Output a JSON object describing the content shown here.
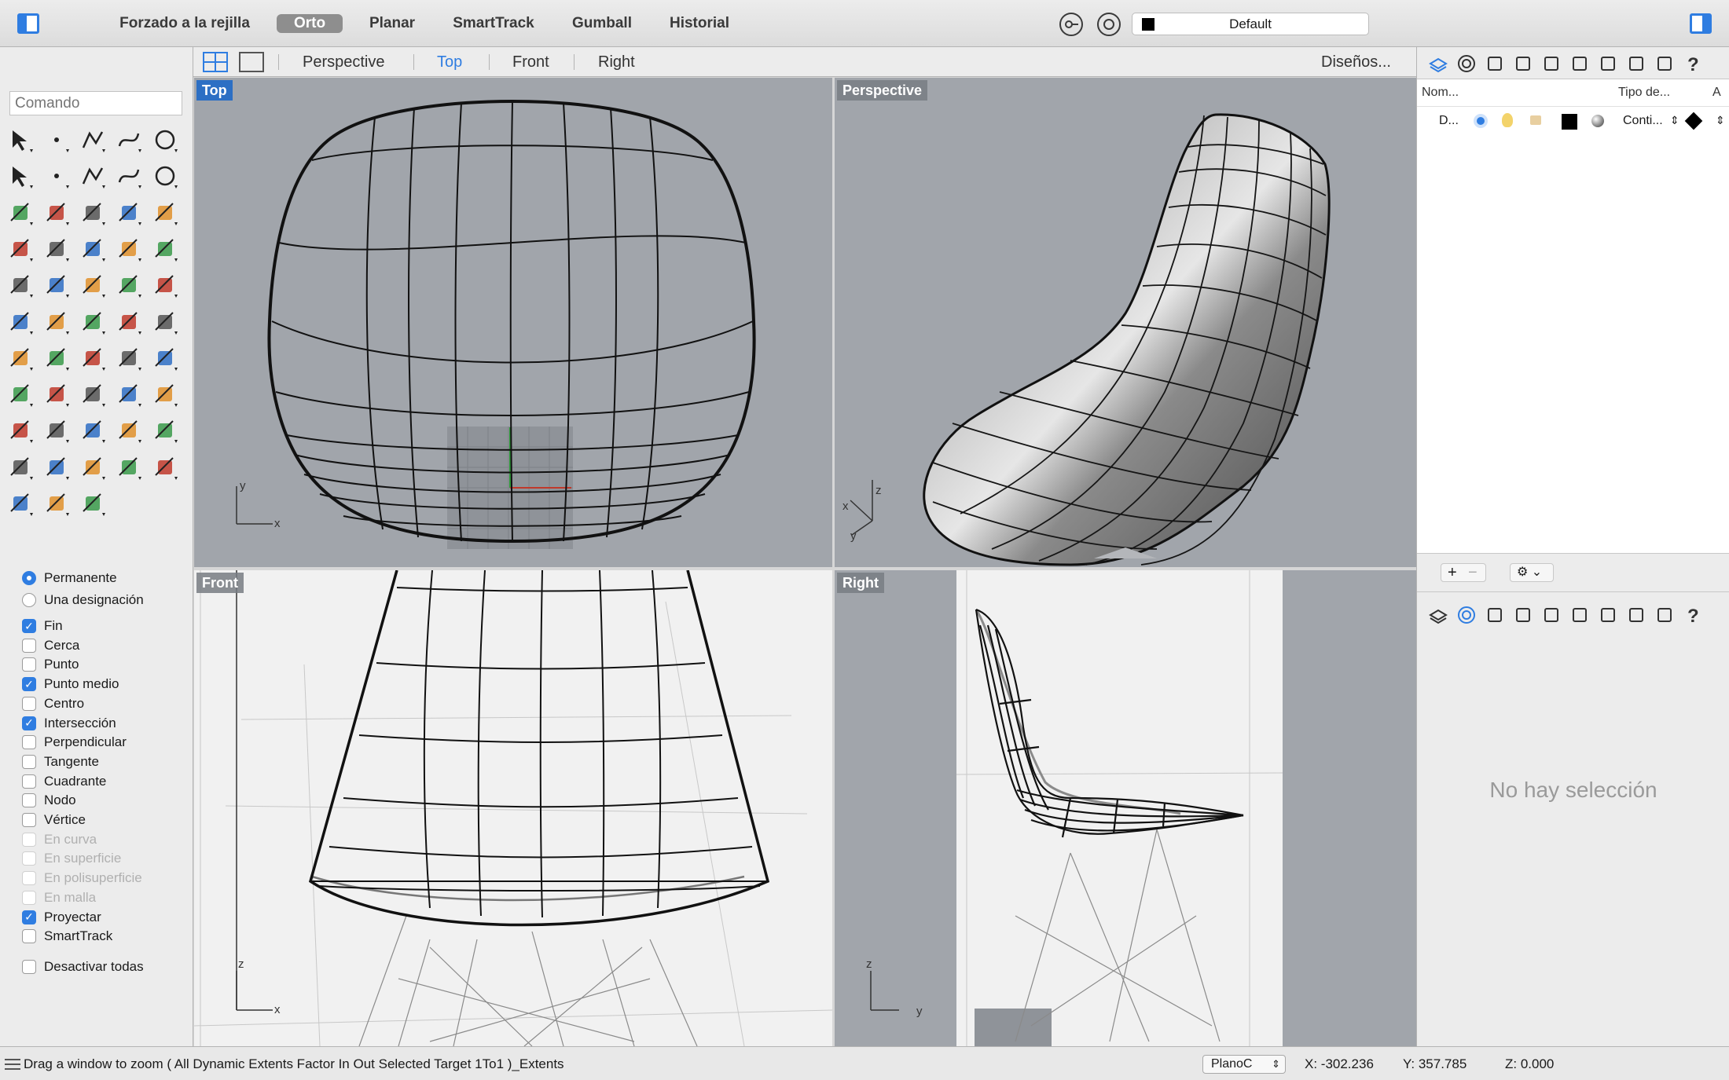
{
  "toolbar": {
    "grid_snap": "Forzado a la rejilla",
    "ortho": "Orto",
    "planar": "Planar",
    "smarttrack": "SmartTrack",
    "gumball": "Gumball",
    "history": "Historial",
    "layer": "Default"
  },
  "command": {
    "placeholder": "Comando"
  },
  "viewport_tabs": {
    "perspective": "Perspective",
    "top": "Top",
    "front": "Front",
    "right": "Right",
    "layouts": "Diseños..."
  },
  "viewports": {
    "top": {
      "title": "Top",
      "axis_a": "y",
      "axis_b": "x"
    },
    "perspective": {
      "title": "Perspective",
      "axis_a": "z",
      "axis_b": "x",
      "axis_c": "y"
    },
    "front": {
      "title": "Front",
      "axis_a": "z",
      "axis_b": "x"
    },
    "right": {
      "title": "Right",
      "axis_a": "z",
      "axis_b": "y"
    }
  },
  "osnap": {
    "mode_permanent": "Permanente",
    "mode_once": "Una designación",
    "items": [
      {
        "label": "Fin",
        "checked": true,
        "enabled": true
      },
      {
        "label": "Cerca",
        "checked": false,
        "enabled": true
      },
      {
        "label": "Punto",
        "checked": false,
        "enabled": true
      },
      {
        "label": "Punto medio",
        "checked": true,
        "enabled": true
      },
      {
        "label": "Centro",
        "checked": false,
        "enabled": true
      },
      {
        "label": "Intersección",
        "checked": true,
        "enabled": true
      },
      {
        "label": "Perpendicular",
        "checked": false,
        "enabled": true
      },
      {
        "label": "Tangente",
        "checked": false,
        "enabled": true
      },
      {
        "label": "Cuadrante",
        "checked": false,
        "enabled": true
      },
      {
        "label": "Nodo",
        "checked": false,
        "enabled": true
      },
      {
        "label": "Vértice",
        "checked": false,
        "enabled": true
      },
      {
        "label": "En curva",
        "checked": false,
        "enabled": false
      },
      {
        "label": "En superficie",
        "checked": false,
        "enabled": false
      },
      {
        "label": "En polisuperficie",
        "checked": false,
        "enabled": false
      },
      {
        "label": "En malla",
        "checked": false,
        "enabled": false
      },
      {
        "label": "Proyectar",
        "checked": true,
        "enabled": true
      },
      {
        "label": "SmartTrack",
        "checked": false,
        "enabled": true
      }
    ],
    "disable_all": "Desactivar todas"
  },
  "layers": {
    "col_name": "Nom...",
    "col_linetype": "Tipo de...",
    "col_extra": "A",
    "row_name": "D...",
    "row_linetype": "Conti...",
    "add": "+",
    "remove": "−"
  },
  "properties": {
    "empty": "No hay selección"
  },
  "status": {
    "message": "Drag a window to zoom ( All Dynamic Extents Factor In Out Selected Target 1To1 )_Extents",
    "cplane": "PlanoC",
    "x": "X: -302.236",
    "y": "Y: 357.785",
    "z": "Z: 0.000"
  },
  "colors": {
    "accent": "#2f7de1",
    "viewport_bg": "#a1a5ab",
    "paper": "#f1f1f1"
  }
}
